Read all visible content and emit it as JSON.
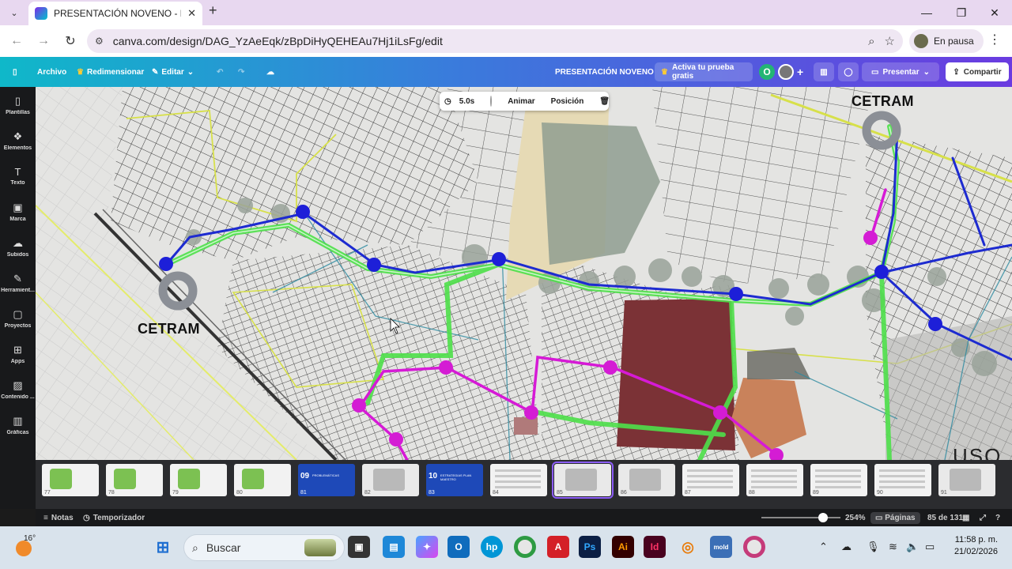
{
  "browser": {
    "tab_title": "PRESENTACIÓN NOVENO - Pre",
    "url": "canva.com/design/DAG_YzAeEqk/zBpDiHyQEHEAu7Hj1iLsFg/edit",
    "profile_status": "En pausa"
  },
  "canva": {
    "menu": [
      "Archivo",
      "Redimensionar",
      "Editar"
    ],
    "doc_title": "PRESENTACIÓN NOVENO",
    "trial": "Activa tu prueba gratis",
    "avatar_initial": "O",
    "present": "Presentar",
    "share": "Compartir"
  },
  "sidebar": {
    "items": [
      {
        "label": "Plantillas",
        "icon": "templates-icon"
      },
      {
        "label": "Elementos",
        "icon": "elements-icon"
      },
      {
        "label": "Texto",
        "icon": "text-icon"
      },
      {
        "label": "Marca",
        "icon": "brand-icon"
      },
      {
        "label": "Subidos",
        "icon": "uploads-icon"
      },
      {
        "label": "Herramient...",
        "icon": "tools-icon"
      },
      {
        "label": "Proyectos",
        "icon": "projects-icon"
      },
      {
        "label": "Apps",
        "icon": "apps-icon"
      },
      {
        "label": "Contenido ...",
        "icon": "content-icon"
      },
      {
        "label": "Gráficas",
        "icon": "charts-icon"
      }
    ]
  },
  "floating_toolbar": {
    "duration": "5.0s",
    "animate": "Animar",
    "position": "Posición"
  },
  "map": {
    "labels": [
      "CETRAM",
      "CETRAM"
    ],
    "partial_label": "USO"
  },
  "pages": {
    "thumbs": [
      {
        "num": "77",
        "kind": "green"
      },
      {
        "num": "78",
        "kind": "green"
      },
      {
        "num": "79",
        "kind": "green"
      },
      {
        "num": "80",
        "kind": "green"
      },
      {
        "num": "81",
        "kind": "blue",
        "big": "09",
        "small": "PROBLEMÁTICAS"
      },
      {
        "num": "82",
        "kind": "map"
      },
      {
        "num": "83",
        "kind": "blue",
        "big": "10",
        "small": "ESTRATEGIAS PLAN MAESTRO"
      },
      {
        "num": "84",
        "kind": "doc"
      },
      {
        "num": "85",
        "kind": "map",
        "selected": true
      },
      {
        "num": "86",
        "kind": "map"
      },
      {
        "num": "87",
        "kind": "doc"
      },
      {
        "num": "88",
        "kind": "doc"
      },
      {
        "num": "89",
        "kind": "doc"
      },
      {
        "num": "90",
        "kind": "doc"
      },
      {
        "num": "91",
        "kind": "map"
      }
    ]
  },
  "footer": {
    "notes": "Notas",
    "timer": "Temporizador",
    "zoom": "254%",
    "pages": "Páginas",
    "page_count": "85 de 131"
  },
  "taskbar": {
    "temperature": "16°",
    "search": "Buscar",
    "time": "11:58 p. m.",
    "date": "21/02/2026"
  }
}
